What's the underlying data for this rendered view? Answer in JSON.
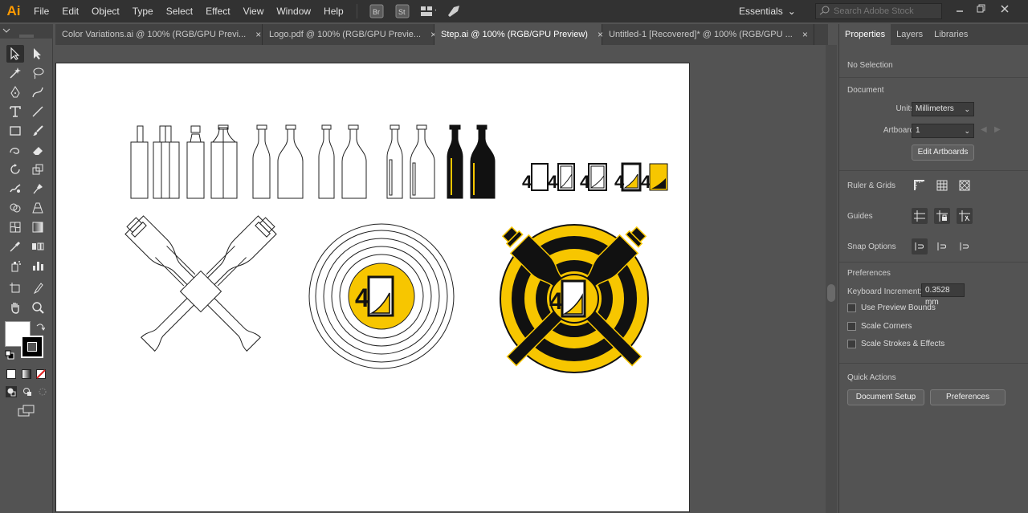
{
  "app": {
    "logo": "Ai",
    "menus": [
      "File",
      "Edit",
      "Object",
      "Type",
      "Select",
      "Effect",
      "View",
      "Window",
      "Help"
    ],
    "workspace": "Essentials",
    "search_placeholder": "Search Adobe Stock",
    "bridge_label": "Br",
    "stock_label": "St"
  },
  "tabs": [
    {
      "label": "Color Variations.ai @ 100% (RGB/GPU Previ...",
      "active": false
    },
    {
      "label": "Logo.pdf @ 100% (RGB/GPU Previe...",
      "active": false
    },
    {
      "label": "Step.ai @ 100% (RGB/GPU Preview)",
      "active": true
    },
    {
      "label": "Untitled-1 [Recovered]* @ 100% (RGB/GPU ...",
      "active": false
    }
  ],
  "panel": {
    "tabs": [
      "Properties",
      "Layers",
      "Libraries"
    ],
    "selection": "No Selection",
    "document_title": "Document",
    "units_label": "Units:",
    "units_value": "Millimeters",
    "artboard_label": "Artboard:",
    "artboard_value": "1",
    "edit_artboards": "Edit Artboards",
    "ruler_grids": "Ruler & Grids",
    "guides": "Guides",
    "snap_options": "Snap Options",
    "preferences_title": "Preferences",
    "keyboard_increment_label": "Keyboard Increment:",
    "keyboard_increment_value": "0.3528 mm",
    "checkboxes": [
      "Use Preview Bounds",
      "Scale Corners",
      "Scale Strokes & Effects"
    ],
    "quick_actions": "Quick Actions",
    "document_setup": "Document Setup",
    "preferences_button": "Preferences"
  },
  "artwork": {
    "logo_digit": "4",
    "accent_color": "#f7c600"
  }
}
